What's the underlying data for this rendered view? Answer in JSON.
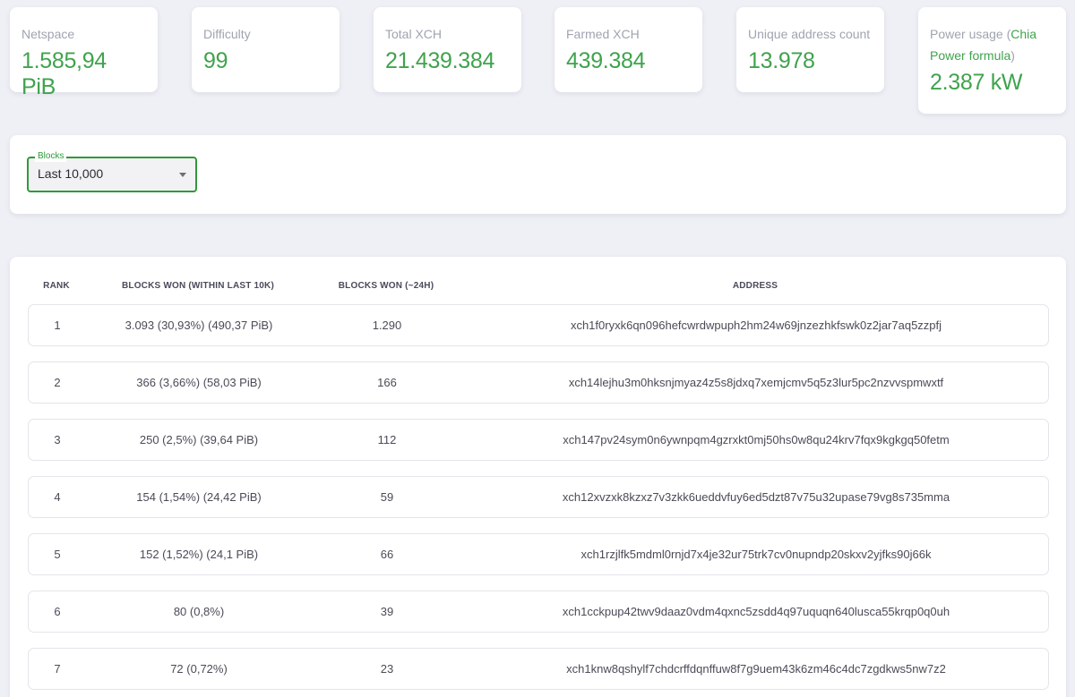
{
  "stats": [
    {
      "label": "Netspace",
      "value": "1.585,94 PiB"
    },
    {
      "label": "Difficulty",
      "value": "99"
    },
    {
      "label": "Total XCH",
      "value": "21.439.384"
    },
    {
      "label": "Farmed XCH",
      "value": "439.384"
    },
    {
      "label": "Unique address count",
      "value": "13.978"
    }
  ],
  "power": {
    "label_prefix": "Power usage (",
    "link_text": "Chia Power formula",
    "label_suffix": ")",
    "value": "2.387 kW"
  },
  "filter": {
    "legend": "Blocks",
    "selected": "Last 10,000"
  },
  "table": {
    "headers": {
      "rank": "RANK",
      "won": "BLOCKS WON (WITHIN LAST 10K)",
      "day": "BLOCKS WON (~24H)",
      "address": "ADDRESS"
    },
    "rows": [
      {
        "rank": "1",
        "won": "3.093 (30,93%) (490,37 PiB)",
        "day": "1.290",
        "address": "xch1f0ryxk6qn096hefcwrdwpuph2hm24w69jnzezhkfswk0z2jar7aq5zzpfj"
      },
      {
        "rank": "2",
        "won": "366 (3,66%) (58,03 PiB)",
        "day": "166",
        "address": "xch14lejhu3m0hksnjmyaz4z5s8jdxq7xemjcmv5q5z3lur5pc2nzvvspmwxtf"
      },
      {
        "rank": "3",
        "won": "250 (2,5%) (39,64 PiB)",
        "day": "112",
        "address": "xch147pv24sym0n6ywnpqm4gzrxkt0mj50hs0w8qu24krv7fqx9kgkgq50fetm"
      },
      {
        "rank": "4",
        "won": "154 (1,54%) (24,42 PiB)",
        "day": "59",
        "address": "xch12xvzxk8kzxz7v3zkk6ueddvfuy6ed5dzt87v75u32upase79vg8s735mma"
      },
      {
        "rank": "5",
        "won": "152 (1,52%) (24,1 PiB)",
        "day": "66",
        "address": "xch1rzjlfk5mdml0rnjd7x4je32ur75trk7cv0nupndp20skxv2yjfks90j66k"
      },
      {
        "rank": "6",
        "won": "80 (0,8%)",
        "day": "39",
        "address": "xch1cckpup42twv9daaz0vdm4qxnc5zsdd4q97uquqn640lusca55krqp0q0uh"
      },
      {
        "rank": "7",
        "won": "72 (0,72%)",
        "day": "23",
        "address": "xch1knw8qshylf7chdcrffdqnffuw8f7g9uem43k6zm46c4dc7zgdkws5nw7z2"
      }
    ]
  }
}
